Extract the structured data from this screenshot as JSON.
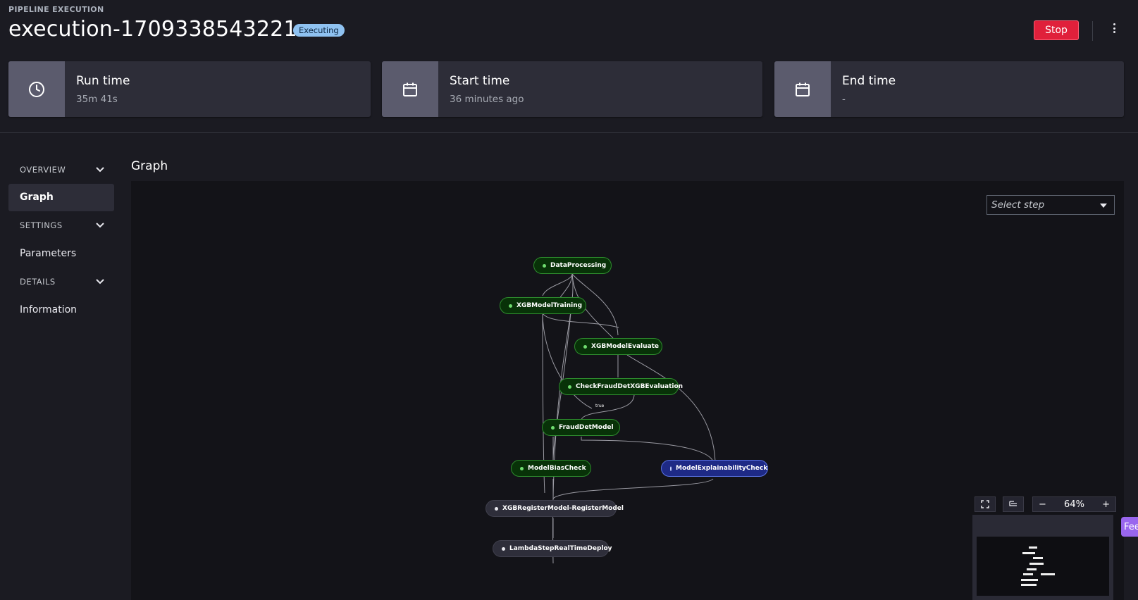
{
  "header": {
    "eyebrow": "PIPELINE EXECUTION",
    "title": "execution-1709338543221",
    "status_badge": "Executing",
    "stop_label": "Stop",
    "more_icon": "kebab-icon"
  },
  "cards": [
    {
      "label": "Run time",
      "value": "35m 41s",
      "icon": "clock-icon"
    },
    {
      "label": "Start time",
      "value": "36 minutes ago",
      "icon": "calendar-icon"
    },
    {
      "label": "End time",
      "value": "-",
      "icon": "calendar-icon"
    }
  ],
  "sidebar": {
    "overview": "OVERVIEW",
    "graph": "Graph",
    "settings": "SETTINGS",
    "parameters": "Parameters",
    "details": "DETAILS",
    "information": "Information"
  },
  "graph": {
    "title": "Graph",
    "select_placeholder": "Select step",
    "edge_label_true": "true",
    "zoom": "64%",
    "nodes": [
      {
        "label": "DataProcessing",
        "status": "succeeded"
      },
      {
        "label": "XGBModelTraining",
        "status": "succeeded"
      },
      {
        "label": "XGBModelEvaluate",
        "status": "succeeded"
      },
      {
        "label": "CheckFraudDetXGBEvaluation",
        "status": "succeeded"
      },
      {
        "label": "FraudDetModel",
        "status": "succeeded"
      },
      {
        "label": "ModelBiasCheck",
        "status": "succeeded"
      },
      {
        "label": "ModelExplainabilityCheck",
        "status": "executing"
      },
      {
        "label": "XGBRegisterModel-RegisterModel",
        "status": "not-started"
      },
      {
        "label": "LambdaStepRealTimeDeploy",
        "status": "not-started"
      }
    ]
  },
  "feedback_tab": "Feedback",
  "colors": {
    "background": "#1b1b22",
    "card": "#2d2d38",
    "stop": "#e0203b",
    "succeeded_node": "#083208",
    "executing_node": "#1e2a86",
    "badge": "#8fc2f1"
  }
}
